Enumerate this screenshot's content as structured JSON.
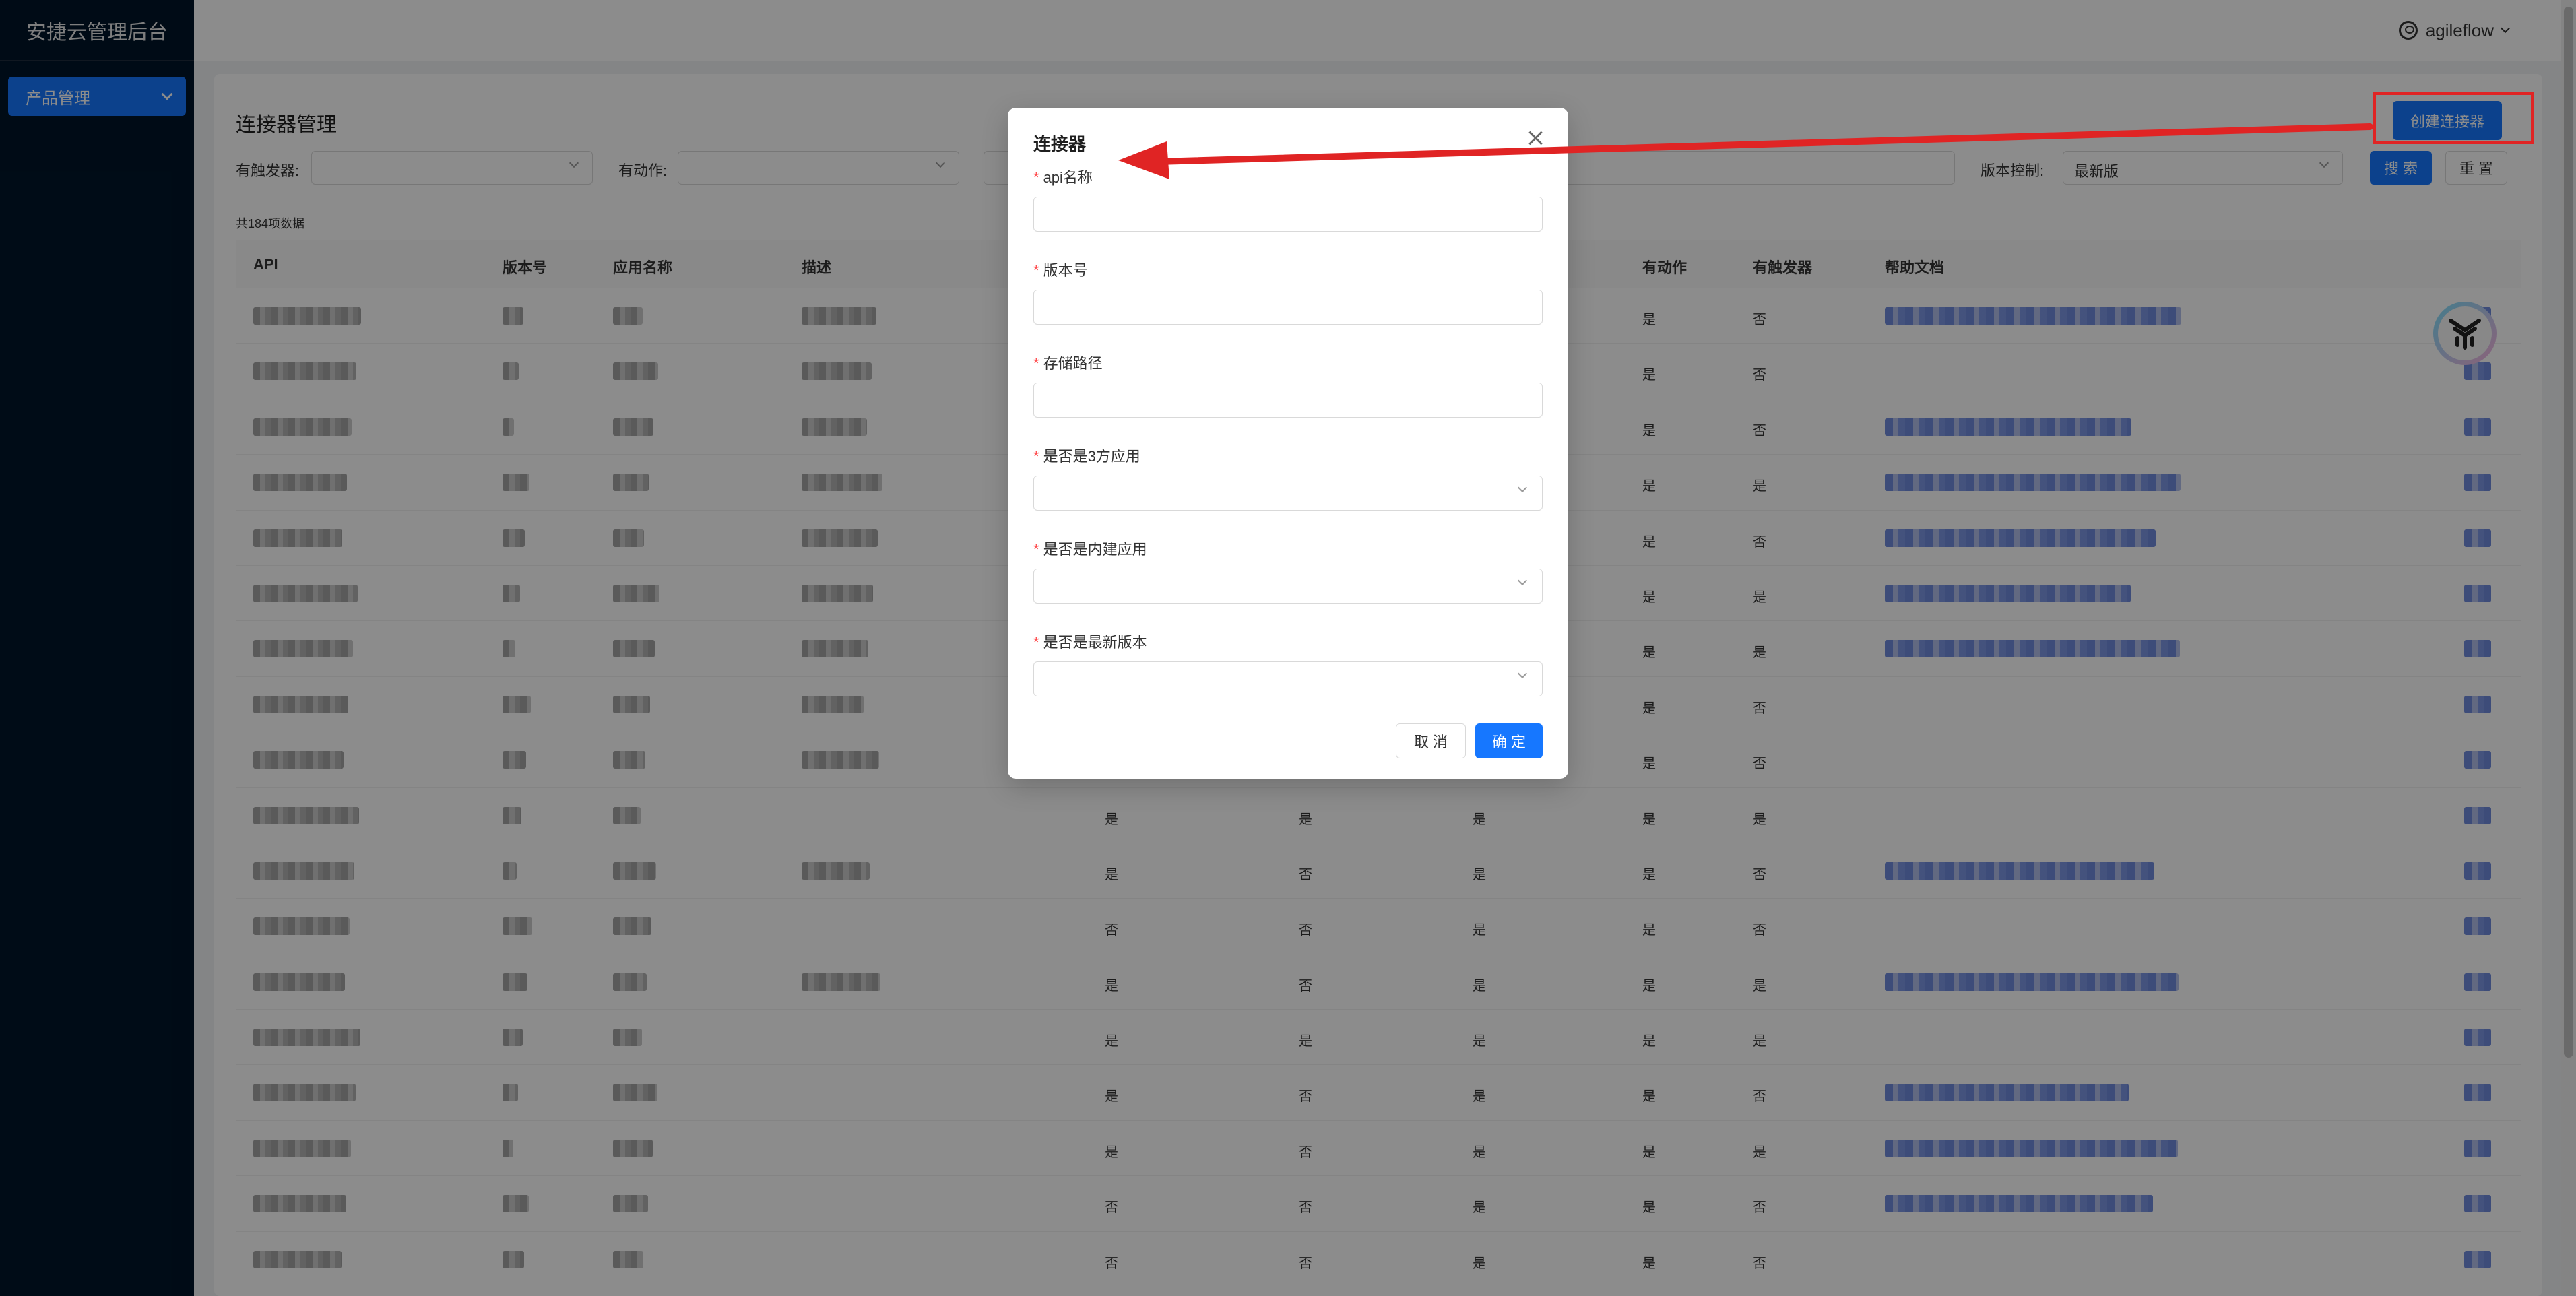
{
  "sidebar": {
    "brand": "安捷云管理后台",
    "menu": [
      {
        "label": "产品管理"
      }
    ]
  },
  "header": {
    "username": "agileflow"
  },
  "page": {
    "title": "连接器管理",
    "create_button": "创建连接器",
    "total": "共184项数据"
  },
  "filters": {
    "trigger_label": "有触发器:",
    "action_label": "有动作:",
    "version_label": "版本控制:",
    "version_value": "最新版",
    "search_button": "搜 索",
    "reset_button": "重 置"
  },
  "table": {
    "columns": [
      "API",
      "版本号",
      "应用名称",
      "描述",
      "有动作",
      "有触发器",
      "帮助文档"
    ],
    "rows": [
      {
        "c1": "",
        "c2": "",
        "c3": "",
        "action": "是",
        "trigger": "否",
        "doc": true
      },
      {
        "c1": "",
        "c2": "",
        "c3": "",
        "action": "是",
        "trigger": "否",
        "doc": false
      },
      {
        "c1": "",
        "c2": "",
        "c3": "",
        "action": "是",
        "trigger": "否",
        "doc": true
      },
      {
        "c1": "",
        "c2": "",
        "c3": "",
        "action": "是",
        "trigger": "是",
        "doc": true
      },
      {
        "c1": "",
        "c2": "",
        "c3": "",
        "action": "是",
        "trigger": "否",
        "doc": true
      },
      {
        "c1": "",
        "c2": "",
        "c3": "",
        "action": "是",
        "trigger": "是",
        "doc": true
      },
      {
        "c1": "",
        "c2": "",
        "c3": "",
        "action": "是",
        "trigger": "是",
        "doc": true
      },
      {
        "c1": "",
        "c2": "",
        "c3": "",
        "action": "是",
        "trigger": "否",
        "doc": false
      },
      {
        "c1": "",
        "c2": "",
        "c3": "",
        "action": "是",
        "trigger": "否",
        "doc": false
      },
      {
        "c1": "是",
        "c2": "是",
        "c3": "是",
        "action": "是",
        "trigger": "是",
        "doc": false
      },
      {
        "c1": "是",
        "c2": "否",
        "c3": "是",
        "action": "是",
        "trigger": "否",
        "doc": true
      },
      {
        "c1": "否",
        "c2": "否",
        "c3": "是",
        "action": "是",
        "trigger": "否",
        "doc": false
      },
      {
        "c1": "是",
        "c2": "否",
        "c3": "是",
        "action": "是",
        "trigger": "是",
        "doc": true
      },
      {
        "c1": "是",
        "c2": "是",
        "c3": "是",
        "action": "是",
        "trigger": "是",
        "doc": false
      },
      {
        "c1": "是",
        "c2": "否",
        "c3": "是",
        "action": "是",
        "trigger": "否",
        "doc": true
      },
      {
        "c1": "是",
        "c2": "否",
        "c3": "是",
        "action": "是",
        "trigger": "是",
        "doc": true
      },
      {
        "c1": "否",
        "c2": "否",
        "c3": "是",
        "action": "是",
        "trigger": "否",
        "doc": true
      },
      {
        "c1": "否",
        "c2": "否",
        "c3": "是",
        "action": "是",
        "trigger": "否",
        "doc": false
      }
    ]
  },
  "modal": {
    "title": "连接器",
    "fields": [
      {
        "label": "api名称",
        "type": "input"
      },
      {
        "label": "版本号",
        "type": "input"
      },
      {
        "label": "存储路径",
        "type": "input"
      },
      {
        "label": "是否是3方应用",
        "type": "select"
      },
      {
        "label": "是否是内建应用",
        "type": "select"
      },
      {
        "label": "是否是最新版本",
        "type": "select"
      }
    ],
    "cancel_button": "取 消",
    "ok_button": "确 定"
  },
  "colors": {
    "primary": "#1677ff",
    "sidebar_bg": "#001529",
    "annotation": "#e02424"
  }
}
